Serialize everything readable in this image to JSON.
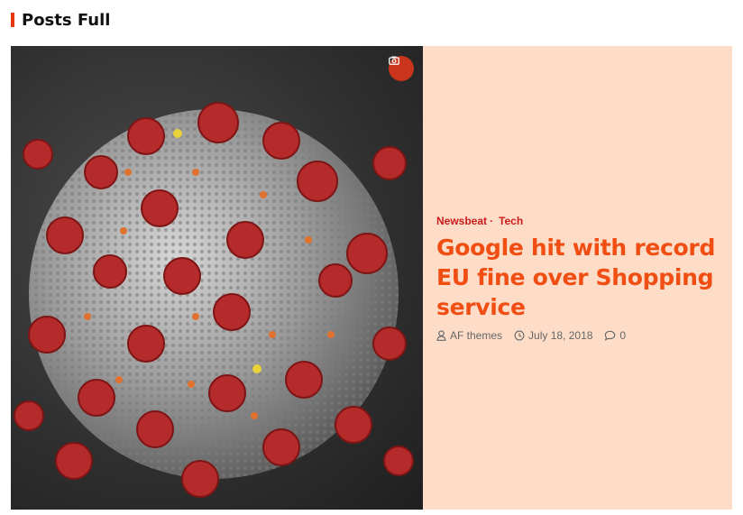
{
  "section": {
    "title": "Posts Full"
  },
  "post": {
    "categories": [
      "Newsbeat",
      "Tech"
    ],
    "title": "Google hit with record EU fine over Shopping service",
    "author": "AF themes",
    "date": "July 18, 2018",
    "comments": "0"
  },
  "colors": {
    "accent": "#e8380d",
    "title": "#f04e12",
    "category": "#cc1b1b",
    "card_bg": "#fddcc8"
  },
  "icons": {
    "badge": "camera-icon",
    "author": "user-icon",
    "date": "clock-icon",
    "comments": "comment-icon"
  }
}
